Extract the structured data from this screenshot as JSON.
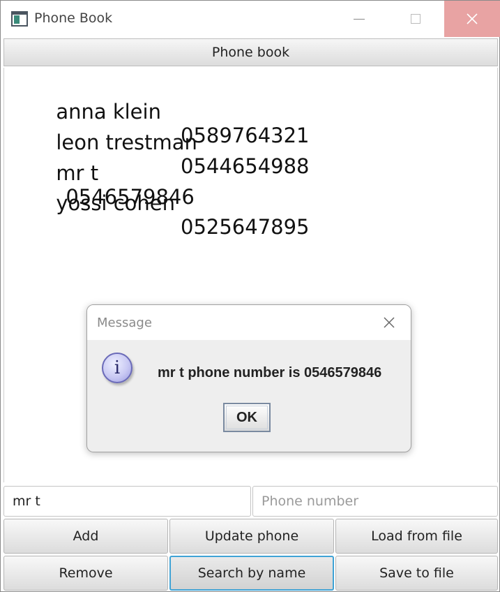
{
  "window": {
    "title": "Phone Book"
  },
  "header": {
    "label": "Phone book"
  },
  "entries": [
    {
      "name": "anna klein",
      "phone": "0589764321"
    },
    {
      "name": "leon trestman",
      "phone": "0544654988"
    },
    {
      "name": "mr t",
      "phone": "0546579846"
    },
    {
      "name": "yossi cohen",
      "phone": "0525647895"
    }
  ],
  "dialog": {
    "title": "Message",
    "icon": "info-icon",
    "message": "mr t phone number is 0546579846",
    "ok_label": "OK"
  },
  "inputs": {
    "name_value": "mr t",
    "name_placeholder": "",
    "phone_value": "",
    "phone_placeholder": "Phone number"
  },
  "buttons": {
    "add": "Add",
    "update_phone": "Update phone",
    "load_from_file": "Load from file",
    "remove": "Remove",
    "search_by_name": "Search by name",
    "save_to_file": "Save to file"
  },
  "colors": {
    "close_button_bg": "#e8a3a3",
    "focus_border": "#3fa3d6"
  }
}
